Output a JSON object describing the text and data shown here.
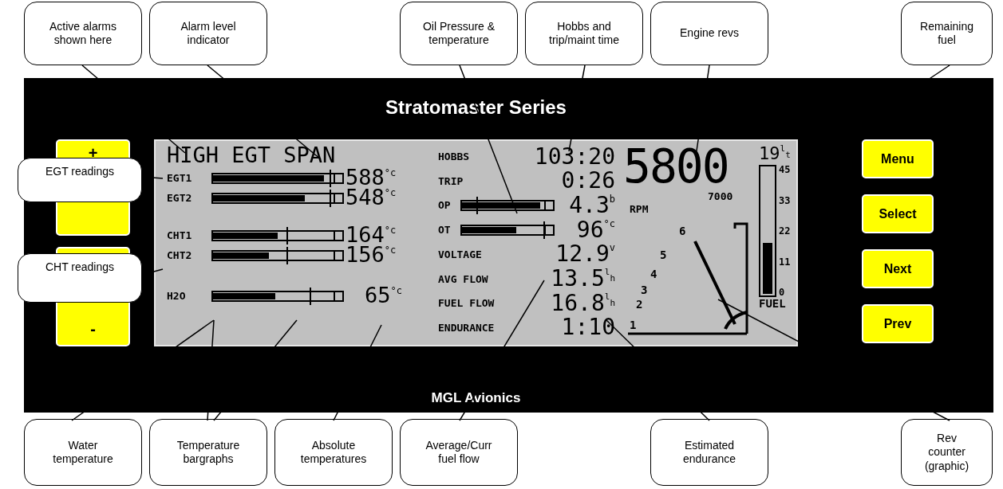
{
  "callouts_top": [
    "Active alarms shown here",
    "Alarm level indicator",
    "Oil Pressure & temperature",
    "Hobbs and trip/maint time",
    "Engine revs",
    "Remaining fuel"
  ],
  "callouts_left": [
    "EGT readings",
    "CHT readings"
  ],
  "device": {
    "title": "Stratomaster Series",
    "left_buttons": [
      "+",
      "-"
    ],
    "right_buttons": [
      "Menu",
      "Select",
      "Next",
      "Prev"
    ],
    "brand": "MGL Avionics",
    "display": {
      "alarm": "HIGH EGT SPAN",
      "bar_groups": [
        {
          "bars": [
            {
              "label": "EGT1",
              "level": 0.86,
              "value": "588",
              "unit": "°c"
            },
            {
              "label": "EGT2",
              "level": 0.71,
              "value": "548",
              "unit": "°c"
            }
          ]
        },
        {
          "bars": [
            {
              "label": "CHT1",
              "level": 0.5,
              "value": "164",
              "unit": "°c"
            },
            {
              "label": "CHT2",
              "level": 0.43,
              "value": "156",
              "unit": "°c"
            }
          ]
        },
        {
          "bars": [
            {
              "label": "H2O",
              "level": 0.48,
              "value": "65",
              "unit": "°c"
            }
          ]
        }
      ],
      "readouts": [
        {
          "kind": "text",
          "label": "HOBBS",
          "value": "103:20"
        },
        {
          "kind": "text",
          "label": "TRIP",
          "value": "0:26"
        },
        {
          "kind": "bar",
          "label": "OP",
          "level": 0.86,
          "value": "4.3",
          "unit": "b"
        },
        {
          "kind": "bar",
          "label": "OT",
          "level": 0.6,
          "value": "96",
          "unit": "°c"
        },
        {
          "kind": "text",
          "label": "VOLTAGE",
          "value": "12.9",
          "unit": "v"
        },
        {
          "kind": "text",
          "label": "AVG FLOW",
          "value": "13.5",
          "unit": "$^{l}$$_{h}$"
        },
        {
          "kind": "text",
          "label": "FUEL FLOW",
          "value": "16.8",
          "unit": "$^{l}$$_{h}$"
        },
        {
          "kind": "text",
          "label": "ENDURANCE",
          "value": "1:10"
        }
      ],
      "rpm": {
        "value": "5800",
        "label": "RPM",
        "max": "7000",
        "scale": [
          "6",
          "5",
          "4",
          "3",
          "2",
          "1"
        ]
      },
      "fuel": {
        "value": "19",
        "unit": "$^{l}$$_{t}$",
        "level": 0.4,
        "scale": [
          "45",
          "33",
          "22",
          "11",
          "0"
        ],
        "label": "FUEL"
      }
    }
  },
  "callouts_bottom": [
    "Water temperature",
    "Temperature bargraphs",
    "Absolute temperatures",
    "Average/Curr fuel flow",
    "Estimated endurance",
    "Rev counter (graphic)"
  ]
}
